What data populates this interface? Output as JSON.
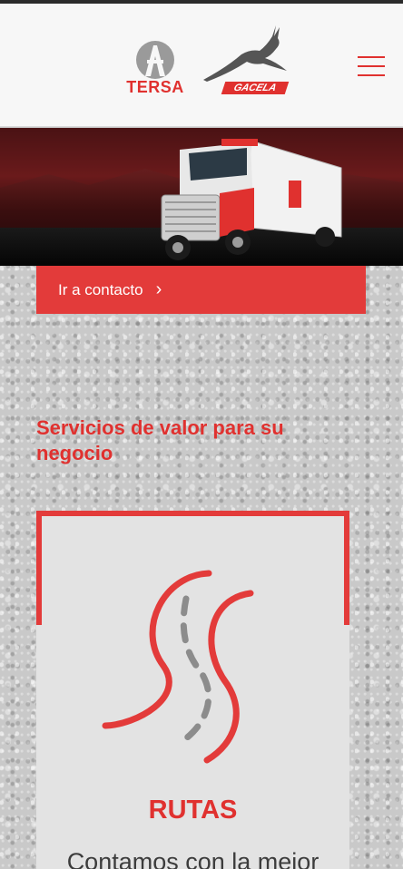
{
  "header": {
    "brand_tersa": "TERSA",
    "brand_gacela": "GACELA",
    "menu_icon": "hamburger-icon"
  },
  "hero": {
    "image": "truck-hero-image"
  },
  "cta": {
    "label": "Ir a contacto",
    "chevron": "›",
    "icon": "chevron-right-icon"
  },
  "services": {
    "title": "Servicios de valor para su negocio",
    "card": {
      "icon": "route-icon",
      "title": "RUTAS",
      "text": "Contamos con la mejor"
    }
  },
  "colors": {
    "accent": "#e33b3a",
    "header_bg": "#f7f7f7",
    "card_bg": "#e3e3e3"
  }
}
